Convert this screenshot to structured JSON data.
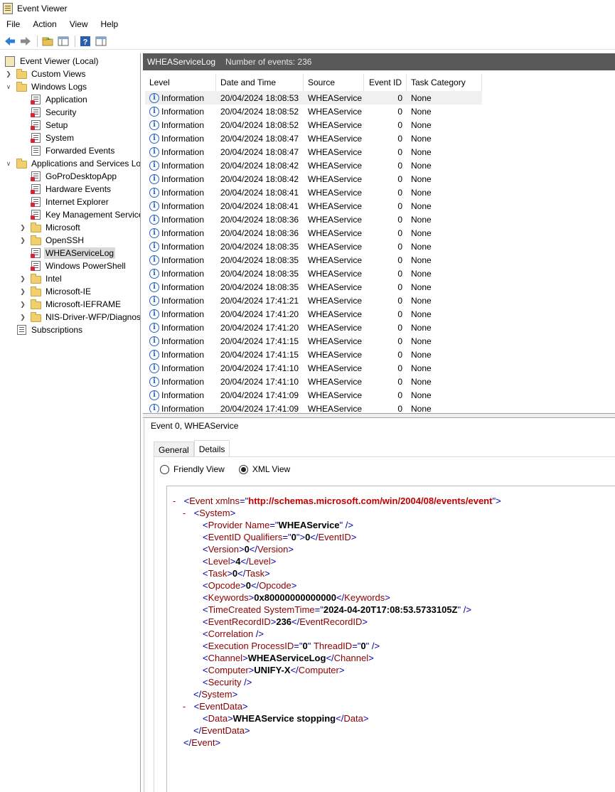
{
  "window": {
    "title": "Event Viewer"
  },
  "menu": [
    "File",
    "Action",
    "View",
    "Help"
  ],
  "tree": {
    "root": "Event Viewer (Local)",
    "custom_views": "Custom Views",
    "windows_logs": "Windows Logs",
    "windows_logs_children": [
      "Application",
      "Security",
      "Setup",
      "System",
      "Forwarded Events"
    ],
    "apps_services": "Applications and Services Lo",
    "apps_children": [
      "GoProDesktopApp",
      "Hardware Events",
      "Internet Explorer",
      "Key Management Service"
    ],
    "apps_folders_a": [
      "Microsoft",
      "OpenSSH"
    ],
    "selected": "WHEAServiceLog",
    "apps_children_b": [
      "Windows PowerShell"
    ],
    "apps_folders_b": [
      "Intel",
      "Microsoft-IE",
      "Microsoft-IEFRAME",
      "NIS-Driver-WFP/Diagnos"
    ],
    "subscriptions": "Subscriptions"
  },
  "log_header": {
    "name": "WHEAServiceLog",
    "count": "Number of events: 236"
  },
  "columns": [
    "Level",
    "Date and Time",
    "Source",
    "Event ID",
    "Task Category"
  ],
  "events": [
    [
      "Information",
      "20/04/2024 18:08:53",
      "WHEAService",
      "0",
      "None"
    ],
    [
      "Information",
      "20/04/2024 18:08:52",
      "WHEAService",
      "0",
      "None"
    ],
    [
      "Information",
      "20/04/2024 18:08:52",
      "WHEAService",
      "0",
      "None"
    ],
    [
      "Information",
      "20/04/2024 18:08:47",
      "WHEAService",
      "0",
      "None"
    ],
    [
      "Information",
      "20/04/2024 18:08:47",
      "WHEAService",
      "0",
      "None"
    ],
    [
      "Information",
      "20/04/2024 18:08:42",
      "WHEAService",
      "0",
      "None"
    ],
    [
      "Information",
      "20/04/2024 18:08:42",
      "WHEAService",
      "0",
      "None"
    ],
    [
      "Information",
      "20/04/2024 18:08:41",
      "WHEAService",
      "0",
      "None"
    ],
    [
      "Information",
      "20/04/2024 18:08:41",
      "WHEAService",
      "0",
      "None"
    ],
    [
      "Information",
      "20/04/2024 18:08:36",
      "WHEAService",
      "0",
      "None"
    ],
    [
      "Information",
      "20/04/2024 18:08:36",
      "WHEAService",
      "0",
      "None"
    ],
    [
      "Information",
      "20/04/2024 18:08:35",
      "WHEAService",
      "0",
      "None"
    ],
    [
      "Information",
      "20/04/2024 18:08:35",
      "WHEAService",
      "0",
      "None"
    ],
    [
      "Information",
      "20/04/2024 18:08:35",
      "WHEAService",
      "0",
      "None"
    ],
    [
      "Information",
      "20/04/2024 18:08:35",
      "WHEAService",
      "0",
      "None"
    ],
    [
      "Information",
      "20/04/2024 17:41:21",
      "WHEAService",
      "0",
      "None"
    ],
    [
      "Information",
      "20/04/2024 17:41:20",
      "WHEAService",
      "0",
      "None"
    ],
    [
      "Information",
      "20/04/2024 17:41:20",
      "WHEAService",
      "0",
      "None"
    ],
    [
      "Information",
      "20/04/2024 17:41:15",
      "WHEAService",
      "0",
      "None"
    ],
    [
      "Information",
      "20/04/2024 17:41:15",
      "WHEAService",
      "0",
      "None"
    ],
    [
      "Information",
      "20/04/2024 17:41:10",
      "WHEAService",
      "0",
      "None"
    ],
    [
      "Information",
      "20/04/2024 17:41:10",
      "WHEAService",
      "0",
      "None"
    ],
    [
      "Information",
      "20/04/2024 17:41:09",
      "WHEAService",
      "0",
      "None"
    ],
    [
      "Information",
      "20/04/2024 17:41:09",
      "WHEAService",
      "0",
      "None"
    ]
  ],
  "details": {
    "title": "Event 0, WHEAService",
    "tabs": [
      "General",
      "Details"
    ],
    "active_tab": "Details",
    "view_options": [
      "Friendly View",
      "XML View"
    ],
    "selected_view": "XML View",
    "xml": {
      "xmlns": "http://schemas.microsoft.com/win/2004/08/events/event",
      "provider_name": "WHEAService",
      "event_id_qualifiers": "0",
      "event_id": "0",
      "version": "0",
      "level": "4",
      "task": "0",
      "opcode": "0",
      "keywords": "0x80000000000000",
      "system_time": "2024-04-20T17:08:53.5733105Z",
      "event_record_id": "236",
      "process_id": "0",
      "thread_id": "0",
      "channel": "WHEAServiceLog",
      "computer": "UNIFY-X",
      "data": "WHEAService stopping"
    }
  }
}
